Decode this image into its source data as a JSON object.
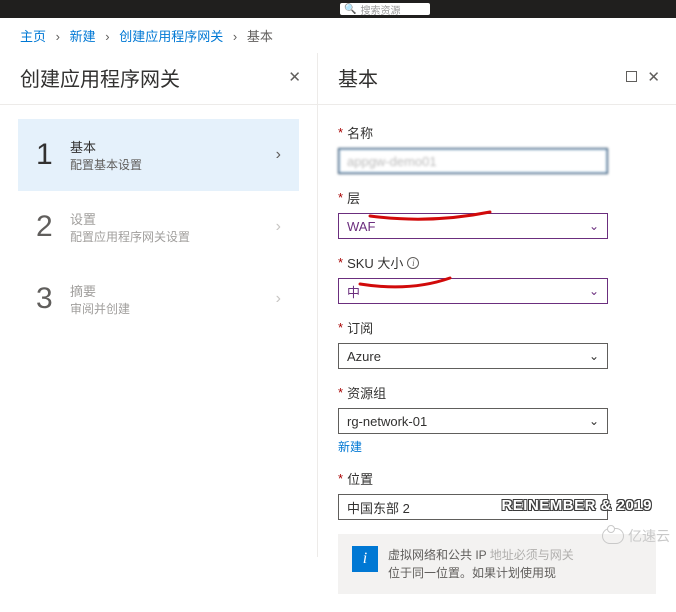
{
  "breadcrumb": {
    "home": "主页",
    "new": "新建",
    "createGateway": "创建应用程序网关",
    "current": "基本"
  },
  "leftBlade": {
    "title": "创建应用程序网关",
    "steps": [
      {
        "num": "1",
        "title": "基本",
        "sub": "配置基本设置"
      },
      {
        "num": "2",
        "title": "设置",
        "sub": "配置应用程序网关设置"
      },
      {
        "num": "3",
        "title": "摘要",
        "sub": "审阅并创建"
      }
    ]
  },
  "rightBlade": {
    "title": "基本",
    "fields": {
      "name": {
        "label": "名称",
        "value": ""
      },
      "tier": {
        "label": "层",
        "value": "WAF"
      },
      "sku": {
        "label": "SKU 大小",
        "value": "中"
      },
      "subscription": {
        "label": "订阅",
        "value": "Azure"
      },
      "resourceGroup": {
        "label": "资源组",
        "value": "",
        "newLink": "新建"
      },
      "location": {
        "label": "位置",
        "value": "中国东部 2"
      }
    },
    "infobox": {
      "line1_a": "虚拟网络和公共 IP ",
      "line1_b": "地址必须与网关",
      "line2": "位于同一位置。如果计划使用现"
    }
  },
  "watermark1": "REINEMBER & 2019",
  "watermark2": "亿速云",
  "searchPlaceholder": "搜索资源"
}
